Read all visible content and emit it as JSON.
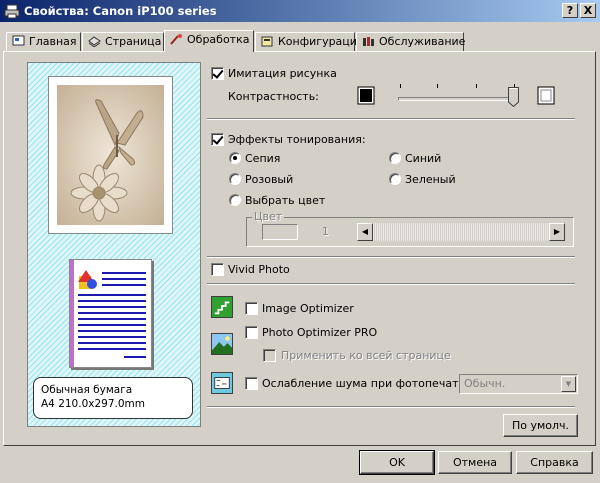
{
  "window": {
    "title": "Свойства: Canon iP100 series",
    "help_btn": "?",
    "close_btn": "X"
  },
  "tabs": [
    {
      "label": "Главная",
      "icon": "main-tab-icon"
    },
    {
      "label": "Страница",
      "icon": "page-setup-tab-icon"
    },
    {
      "label": "Обработка",
      "icon": "effects-tab-icon",
      "active": true
    },
    {
      "label": "Конфигурации",
      "icon": "profiles-tab-icon"
    },
    {
      "label": "Обслуживание",
      "icon": "maintenance-tab-icon"
    }
  ],
  "preview": {
    "paper_line1": "Обычная бумага",
    "paper_line2": "A4 210.0x297.0mm"
  },
  "simulate": {
    "label": "Имитация рисунка",
    "checked": true,
    "contrast_label": "Контрастность:",
    "contrast_level": 1.0
  },
  "toning": {
    "label": "Эффекты тонирования:",
    "checked": true,
    "options": {
      "sepia": "Сепия",
      "pink": "Розовый",
      "choose": "Выбрать цвет",
      "blue": "Синий",
      "green": "Зеленый"
    },
    "selected": "sepia",
    "color_group": "Цвет",
    "color_value": "1"
  },
  "vivid": {
    "label": "Vivid Photo",
    "checked": false
  },
  "image_optimizer": {
    "label": "Image Optimizer",
    "checked": false
  },
  "photo_optimizer": {
    "label": "Photo Optimizer PRO",
    "checked": false,
    "apply_all": "Применить ко всей странице"
  },
  "noise": {
    "label": "Ослабление шума при фотопечати",
    "checked": false,
    "combo_value": "Обычн."
  },
  "buttons": {
    "defaults": "По умолч.",
    "ok": "OK",
    "cancel": "Отмена",
    "help": "Справка"
  },
  "colors": {
    "title_start": "#0a246a",
    "title_end": "#a6caf0",
    "preview_stripes": "#99e3ef",
    "sepia": "#d8c8b0"
  }
}
